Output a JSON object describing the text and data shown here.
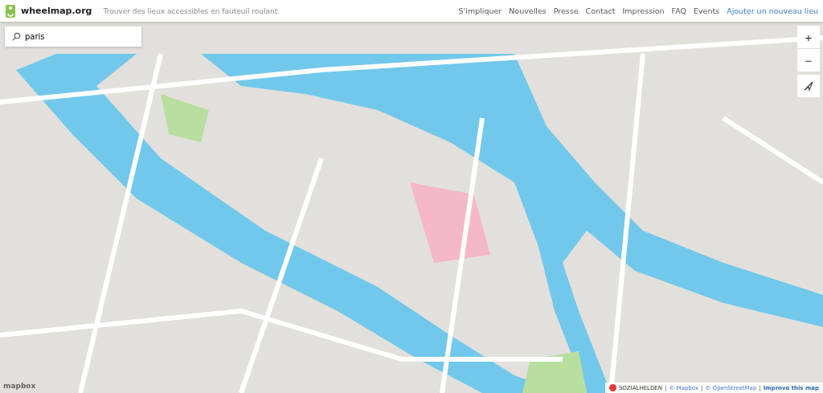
{
  "header": {
    "logo": "wheelmap.org",
    "tagline": "Trouver des lieux accessibles en fauteuil roulant.",
    "nav": [
      {
        "label": "S'impliquer",
        "kind": "plain"
      },
      {
        "label": "Nouvelles",
        "kind": "plain"
      },
      {
        "label": "Presse",
        "kind": "plain"
      },
      {
        "label": "Contact",
        "kind": "plain"
      },
      {
        "label": "Impression",
        "kind": "plain"
      },
      {
        "label": "FAQ",
        "kind": "plain"
      },
      {
        "label": "Events",
        "kind": "plain"
      },
      {
        "label": "Ajouter un nouveau lieu",
        "kind": "primary"
      }
    ]
  },
  "search": {
    "value": "paris"
  },
  "map_controls": {
    "zoom_in": "+",
    "zoom_out": "−"
  },
  "attribution": {
    "sozialhelden": "SOZIALHELDEN",
    "mapbox_logo": "mapbox",
    "separator": "|",
    "links": [
      {
        "label": "© Mapbox",
        "kind": "plain"
      },
      {
        "label": "© OpenStreetMap",
        "kind": "plain"
      },
      {
        "label": "Improve this map",
        "kind": "bold"
      }
    ]
  }
}
